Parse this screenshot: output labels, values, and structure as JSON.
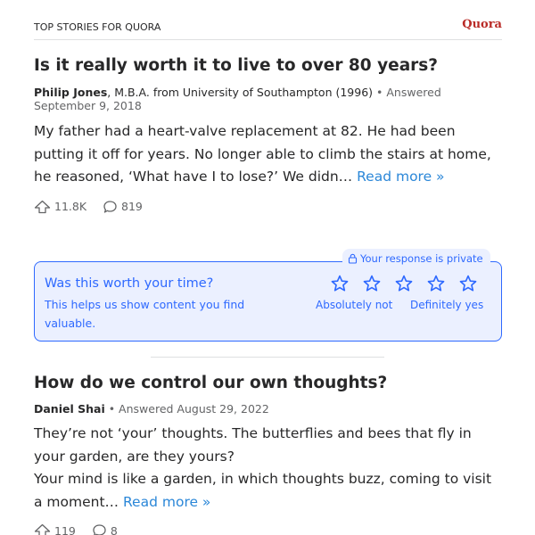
{
  "header": {
    "title": "TOP STORIES FOR QUORA",
    "brand": "Quora"
  },
  "stories": [
    {
      "title": "Is it really worth it to live to over 80 years?",
      "author": "Philip Jones",
      "credential": ", M.B.A. from University of Southampton (1996)",
      "answered": " • Answered September 9, 2018",
      "body": [
        "My father had a heart-valve replacement at 82. He had been putting it off for years. No longer able to climb the stairs at home, he reasoned, ‘What have I to lose?’ We didn… "
      ],
      "read_more": "Read more »",
      "upvotes": "11.8K",
      "comments": "819"
    },
    {
      "title": "How do we control our own thoughts?",
      "author": "Daniel Shai",
      "credential": "",
      "answered": " • Answered August 29, 2022",
      "body": [
        "They’re not ‘your’ thoughts. The butterflies and bees that fly in your garden, are they yours?",
        "Your mind is like a garden, in which thoughts buzz, coming to visit a moment… "
      ],
      "read_more": "Read more »",
      "upvotes": "119",
      "comments": "8"
    }
  ],
  "survey": {
    "question": "Was this worth your time?",
    "subtitle": "This helps us show content you find valuable.",
    "privacy": "Your response is private",
    "stars": 5,
    "rating_selected": 0,
    "low_label": "Absolutely not",
    "high_label": "Definitely yes"
  },
  "colors": {
    "accent": "#2e69ff",
    "brand": "#b92b27",
    "link": "#2b87d8"
  }
}
